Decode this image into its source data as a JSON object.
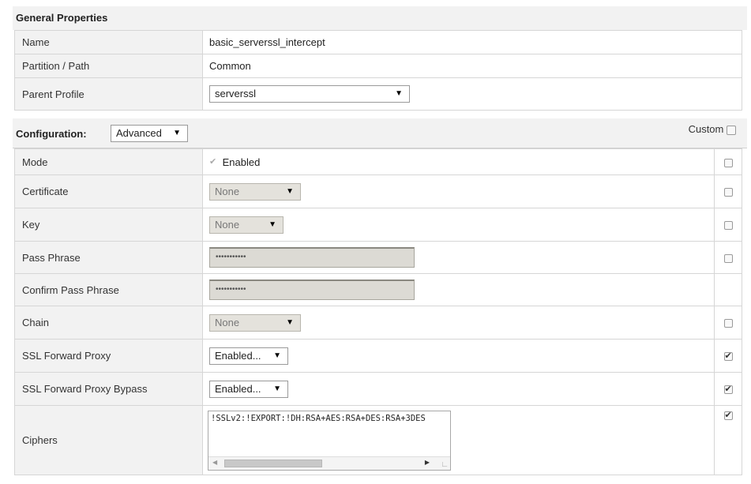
{
  "general": {
    "heading": "General Properties",
    "rows": [
      {
        "label": "Name",
        "value": "basic_serverssl_intercept"
      },
      {
        "label": "Partition / Path",
        "value": "Common"
      },
      {
        "label": "Parent Profile",
        "value": "serverssl"
      }
    ]
  },
  "configuration": {
    "label": "Configuration:",
    "mode_select": "Advanced",
    "custom_label": "Custom",
    "custom_checked": false,
    "rows": {
      "mode": {
        "label": "Mode",
        "value": "Enabled",
        "checked": true,
        "custom": false
      },
      "certificate": {
        "label": "Certificate",
        "value": "None",
        "custom": false
      },
      "key": {
        "label": "Key",
        "value": "None",
        "custom": false
      },
      "pass_phrase": {
        "label": "Pass Phrase",
        "value": "•••••••••••",
        "custom": false
      },
      "confirm_pass_phrase": {
        "label": "Confirm Pass Phrase",
        "value": "•••••••••••"
      },
      "chain": {
        "label": "Chain",
        "value": "None",
        "custom": false
      },
      "ssl_forward_proxy": {
        "label": "SSL Forward Proxy",
        "value": "Enabled...",
        "custom": true
      },
      "ssl_forward_proxy_bypass": {
        "label": "SSL Forward Proxy Bypass",
        "value": "Enabled...",
        "custom": true
      },
      "ciphers": {
        "label": "Ciphers",
        "value": "!SSLv2:!EXPORT:!DH:RSA+AES:RSA+DES:RSA+3DES",
        "custom": true
      }
    }
  },
  "icons": {
    "dropdown_arrow": "triangle-down",
    "checkbox_checked": "check-mark"
  }
}
